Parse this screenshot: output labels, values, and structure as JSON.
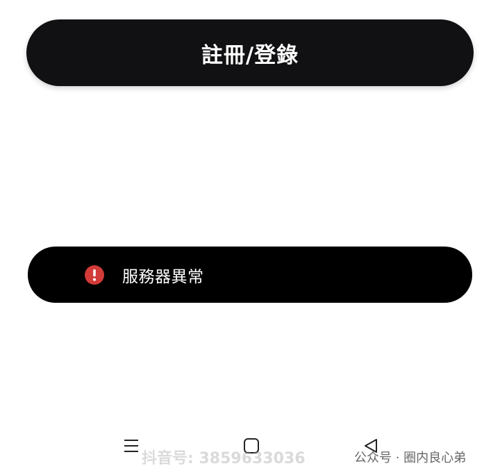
{
  "primary_button": {
    "label": "註冊/登錄"
  },
  "toast": {
    "message": "服務器異常",
    "icon": "error-exclamation-icon",
    "icon_color": "#d23b38"
  },
  "navigation_bar": {
    "menu_icon": "menu-icon",
    "home_icon": "home-square-icon",
    "back_icon": "back-triangle-icon"
  },
  "watermarks": {
    "douyin": "抖音号: 3859633036",
    "wechat": "公众号 · 圈内良心弟"
  }
}
